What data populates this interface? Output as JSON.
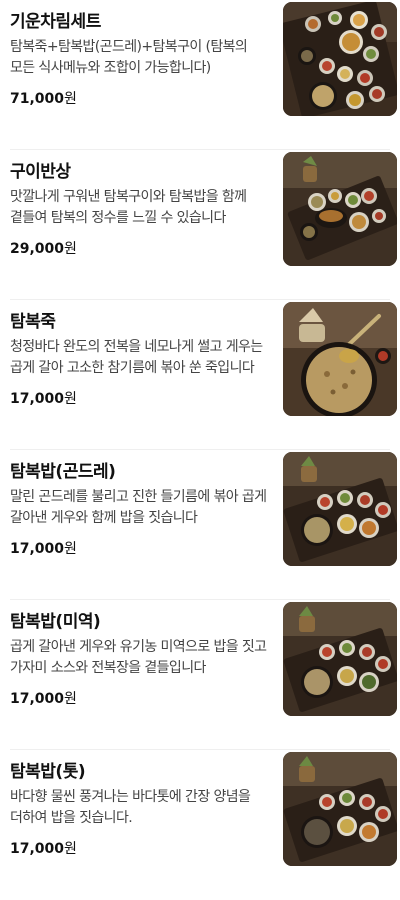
{
  "menu": {
    "currency": "원",
    "items": [
      {
        "name": "기운차림세트",
        "description": "탐복죽+탐복밥(곤드레)+탐복구이 (탐복의 모든 식사메뉴와 조합이 가능합니다)",
        "price": "71,000",
        "photo": "set-tray"
      },
      {
        "name": "구이반상",
        "description": "맛깔나게 구워낸 탐복구이와 탐복밥을 함께 곁들여 탐복의 정수를 느낄 수 있습니다",
        "price": "29,000",
        "photo": "grill-tray"
      },
      {
        "name": "탐복죽",
        "description": "청정바다 완도의 전복을 네모나게 썰고 게우는 곱게 갈아 고소한 참기름에 볶아 쑨 죽입니다",
        "price": "17,000",
        "photo": "porridge-bowl"
      },
      {
        "name": "탐복밥(곤드레)",
        "description": "말린 곤드레를 불리고 진한 들기름에 볶아 곱게 갈아낸 게우와 함께 밥을 짓습니다",
        "price": "17,000",
        "photo": "rice-tray"
      },
      {
        "name": "탐복밥(미역)",
        "description": "곱게 갈아낸 게우와 유기농 미역으로 밥을 짓고 가자미 소스와 전복장을 곁들입니다",
        "price": "17,000",
        "photo": "rice-tray"
      },
      {
        "name": "탐복밥(톳)",
        "description": "바다향 물씬 풍겨나는 바다톳에 간장 양념을 더하여 밥을 짓습니다.",
        "price": "17,000",
        "photo": "rice-tray"
      }
    ]
  }
}
